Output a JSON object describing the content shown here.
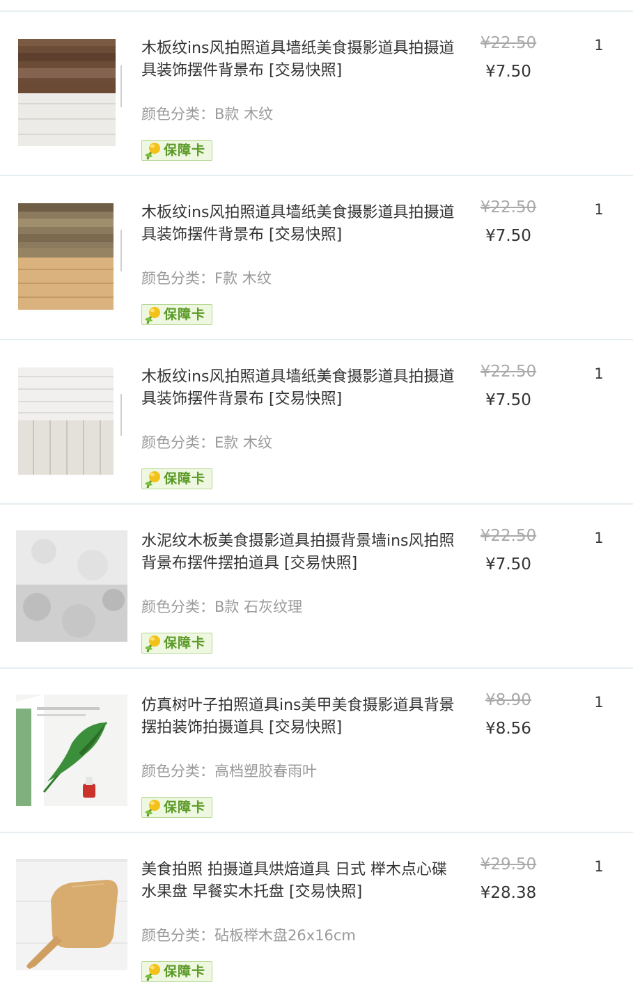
{
  "colors": {
    "divider": "#e6eef2",
    "title_text": "#333333",
    "variant_text": "#9a9a9a",
    "old_price": "#a9a9a9",
    "badge_green": "#5a9a26",
    "badge_bg": "#eef7df"
  },
  "items": [
    {
      "title": "木板纹ins风拍照道具墙纸美食摄影道具拍摄道具装饰摆件背景布 [交易快照]",
      "variant": "颜色分类：B款 木纹",
      "badge": "保障卡",
      "original_price": "¥22.50",
      "price": "¥7.50",
      "quantity": "1",
      "thumbnail": "dark-wood-over-white-wood"
    },
    {
      "title": "木板纹ins风拍照道具墙纸美食摄影道具拍摄道具装饰摆件背景布 [交易快照]",
      "variant": "颜色分类：F款 木纹",
      "badge": "保障卡",
      "original_price": "¥22.50",
      "price": "¥7.50",
      "quantity": "1",
      "thumbnail": "rustic-wood-over-light-wood"
    },
    {
      "title": "木板纹ins风拍照道具墙纸美食摄影道具拍摄道具装饰摆件背景布 [交易快照]",
      "variant": "颜色分类：E款 木纹",
      "badge": "保障卡",
      "original_price": "¥22.50",
      "price": "¥7.50",
      "quantity": "1",
      "thumbnail": "white-wood-planks"
    },
    {
      "title": "水泥纹木板美食摄影道具拍摄背景墙ins风拍照背景布摆件摆拍道具 [交易快照]",
      "variant": "颜色分类：B款 石灰纹理",
      "badge": "保障卡",
      "original_price": "¥22.50",
      "price": "¥7.50",
      "quantity": "1",
      "thumbnail": "grey-concrete-texture"
    },
    {
      "title": "仿真树叶子拍照道具ins美甲美食摄影道具背景摆拍装饰拍摄道具 [交易快照]",
      "variant": "颜色分类：高档塑胶春雨叶",
      "badge": "保障卡",
      "original_price": "¥8.90",
      "price": "¥8.56",
      "quantity": "1",
      "thumbnail": "green-leaf-with-book"
    },
    {
      "title": "美食拍照 拍摄道具烘焙道具 日式 榉木点心碟水果盘 早餐实木托盘 [交易快照]",
      "variant": "颜色分类：砧板榉木盘26x16cm",
      "badge": "保障卡",
      "original_price": "¥29.50",
      "price": "¥28.38",
      "quantity": "1",
      "thumbnail": "wooden-cutting-board"
    }
  ]
}
